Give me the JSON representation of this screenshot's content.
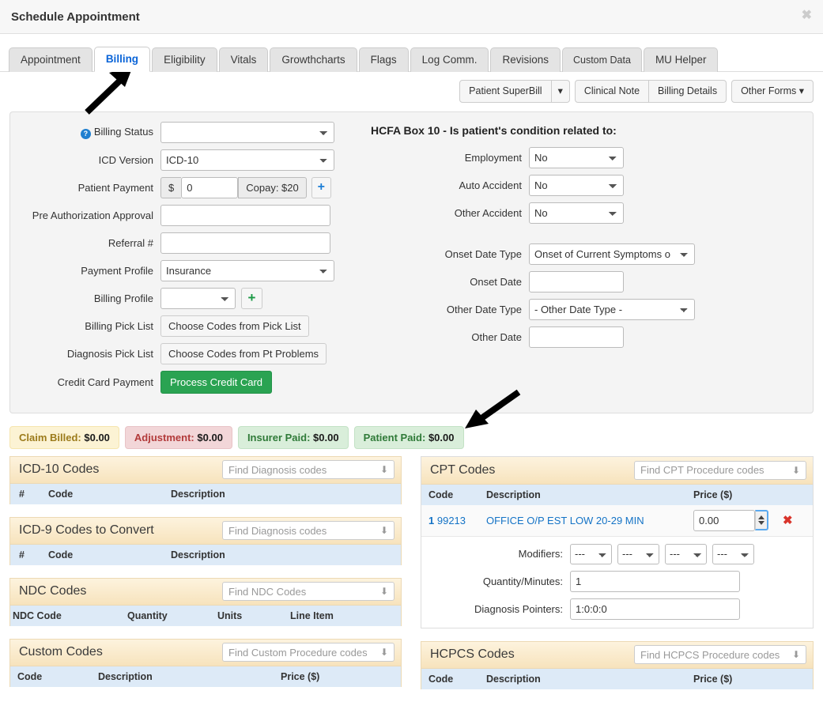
{
  "window": {
    "title": "Schedule Appointment",
    "close_label": "✖"
  },
  "tabs": [
    {
      "label": "Appointment",
      "active": false
    },
    {
      "label": "Billing",
      "active": true
    },
    {
      "label": "Eligibility",
      "active": false
    },
    {
      "label": "Vitals",
      "active": false
    },
    {
      "label": "Growthcharts",
      "active": false
    },
    {
      "label": "Flags",
      "active": false
    },
    {
      "label": "Log Comm.",
      "active": false
    },
    {
      "label": "Revisions",
      "active": false
    },
    {
      "label": "Custom Data",
      "active": false
    },
    {
      "label": "MU Helper",
      "active": false
    }
  ],
  "actionbar": {
    "patient_superbill": "Patient SuperBill",
    "superbill_caret": "▾",
    "clinical_note": "Clinical Note",
    "billing_details": "Billing Details",
    "other_forms": "Other Forms",
    "other_forms_caret": "▾"
  },
  "billing_form": {
    "help_glyph": "?",
    "labels": {
      "billing_status": "Billing Status",
      "icd_version": "ICD Version",
      "patient_payment": "Patient Payment",
      "pre_auth": "Pre Authorization Approval",
      "referral": "Referral #",
      "payment_profile": "Payment Profile",
      "billing_profile": "Billing Profile",
      "billing_pick_list": "Billing Pick List",
      "diagnosis_pick_list": "Diagnosis Pick List",
      "credit_card_payment": "Credit Card Payment"
    },
    "values": {
      "billing_status": "",
      "icd_version": "ICD-10",
      "currency_symbol": "$",
      "payment_amount": "0",
      "copay": "Copay: $20",
      "add_payment_glyph": "+",
      "pre_auth": "",
      "referral": "",
      "payment_profile": "Insurance",
      "billing_profile": "",
      "add_profile_glyph": "+",
      "billing_pick_list_btn": "Choose Codes from Pick List",
      "diagnosis_pick_list_btn": "Choose Codes from Pt Problems",
      "process_credit_card_btn": "Process Credit Card"
    }
  },
  "hcfa": {
    "title": "HCFA Box 10 - Is patient's condition related to:",
    "labels": {
      "employment": "Employment",
      "auto_accident": "Auto Accident",
      "other_accident": "Other Accident",
      "onset_date_type": "Onset Date Type",
      "onset_date": "Onset Date",
      "other_date_type": "Other Date Type",
      "other_date": "Other Date"
    },
    "values": {
      "employment": "No",
      "auto_accident": "No",
      "other_accident": "No",
      "onset_date_type": "Onset of Current Symptoms o",
      "onset_date": "",
      "other_date_type": "- Other Date Type -",
      "other_date": ""
    }
  },
  "badges": [
    {
      "label": "Claim Billed:",
      "amount": "$0.00",
      "color": "#fcf3d4"
    },
    {
      "label": "Adjustment:",
      "amount": "$0.00",
      "color": "#f2d6d8"
    },
    {
      "label": "Insurer Paid:",
      "amount": "$0.00",
      "color": "#d9eeda"
    },
    {
      "label": "Patient Paid:",
      "amount": "$0.00",
      "color": "#d9eeda"
    }
  ],
  "panels": {
    "icd10": {
      "title": "ICD-10 Codes",
      "search_placeholder": "Find Diagnosis codes",
      "columns": [
        "#",
        "Code",
        "Description"
      ],
      "rows": []
    },
    "icd9": {
      "title": "ICD-9 Codes to Convert",
      "search_placeholder": "Find Diagnosis codes",
      "columns": [
        "#",
        "Code",
        "Description"
      ],
      "rows": []
    },
    "ndc": {
      "title": "NDC Codes",
      "search_placeholder": "Find NDC Codes",
      "columns": [
        "NDC Code",
        "Quantity",
        "Units",
        "Line Item"
      ],
      "rows": []
    },
    "custom": {
      "title": "Custom Codes",
      "search_placeholder": "Find Custom Procedure codes",
      "columns": [
        "Code",
        "Description",
        "Price ($)"
      ],
      "rows": []
    },
    "cpt": {
      "title": "CPT Codes",
      "search_placeholder": "Find CPT Procedure codes",
      "columns": [
        "Code",
        "Description",
        "Price ($)"
      ],
      "row": {
        "index": "1",
        "code": "99213",
        "description": "OFFICE O/P EST LOW 20-29 MIN",
        "price": "0.00",
        "delete_glyph": "✖"
      },
      "detail": {
        "modifiers_label": "Modifiers:",
        "modifiers": [
          "---",
          "---",
          "---",
          "---"
        ],
        "quantity_label": "Quantity/Minutes:",
        "quantity": "1",
        "diagnosis_pointers_label": "Diagnosis Pointers:",
        "diagnosis_pointers": "1:0:0:0"
      }
    },
    "hcpcs": {
      "title": "HCPCS Codes",
      "search_placeholder": "Find HCPCS Procedure codes",
      "columns": [
        "Code",
        "Description",
        "Price ($)"
      ],
      "rows": []
    }
  }
}
